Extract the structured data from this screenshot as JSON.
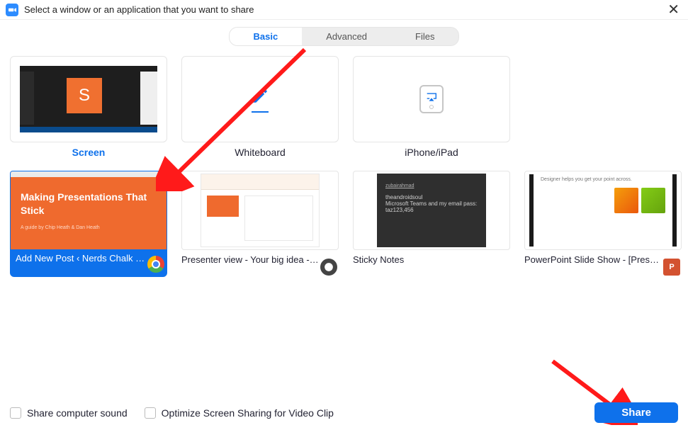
{
  "titlebar": {
    "title": "Select a window or an application that you want to share"
  },
  "tabs": {
    "basic": "Basic",
    "advanced": "Advanced",
    "files": "Files",
    "active": "basic"
  },
  "top_tiles": {
    "screen": "Screen",
    "whiteboard": "Whiteboard",
    "iphone": "iPhone/iPad"
  },
  "windows": [
    {
      "label": "Add New Post ‹ Nerds Chalk — ...",
      "app": "chrome",
      "selected": true,
      "preview": {
        "line1": "Making Presentations That Stick",
        "line2": "A guide by Chip Heath & Dan Heath"
      }
    },
    {
      "label": "Presenter view - Your big idea - G...",
      "app": "google",
      "selected": false
    },
    {
      "label": "Sticky Notes",
      "app": "",
      "selected": false,
      "preview": {
        "hdr": "zubairahmad",
        "ln1": "theandroidsoul",
        "ln2": "Microsoft Teams and my email pass:",
        "ln3": "taz123,456"
      }
    },
    {
      "label": "PowerPoint Slide Show - [Present...",
      "app": "powerpoint",
      "selected": false,
      "preview": {
        "txt": "Designer helps you get your point across."
      }
    }
  ],
  "footer": {
    "share_sound": "Share computer sound",
    "optimize": "Optimize Screen Sharing for Video Clip",
    "share_btn": "Share"
  },
  "colors": {
    "accent": "#0e71eb",
    "orange": "#ef6a2e"
  }
}
